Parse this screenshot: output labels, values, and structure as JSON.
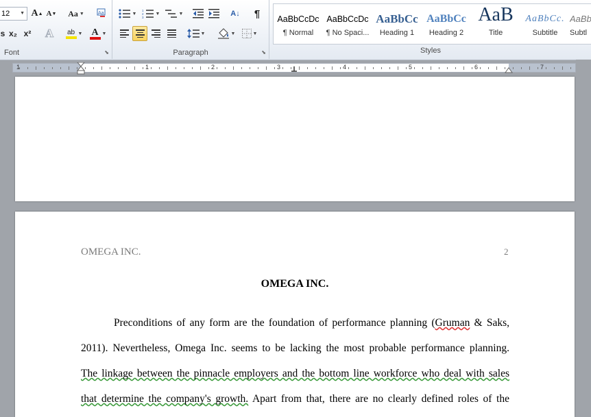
{
  "ribbon": {
    "font": {
      "label": "Font",
      "size_value": "12",
      "grow_label": "A",
      "shrink_label": "A",
      "case_label": "Aa",
      "subscript_label": "x₂",
      "superscript_label": "x²",
      "effects_label": "A",
      "highlight_label": "ab",
      "color_label": "A",
      "clear_label": "A"
    },
    "paragraph": {
      "label": "Paragraph",
      "pilcrow": "¶",
      "sort_label": "A↓"
    },
    "styles": {
      "label": "Styles",
      "items": [
        {
          "preview": "AaBbCcDc",
          "name": "¶ Normal"
        },
        {
          "preview": "AaBbCcDc",
          "name": "¶ No Spaci..."
        },
        {
          "preview": "AaBbCc",
          "name": "Heading 1"
        },
        {
          "preview": "AaBbCc",
          "name": "Heading 2"
        },
        {
          "preview": "AaB",
          "name": "Title"
        },
        {
          "preview": "AaBbCc.",
          "name": "Subtitle"
        },
        {
          "preview": "AaBbCc",
          "name": "Subtl"
        }
      ]
    }
  },
  "ruler": {
    "numbers": [
      "1",
      "1",
      "2",
      "3",
      "4",
      "5",
      "6",
      "7"
    ]
  },
  "document": {
    "header_left": "OMEGA INC.",
    "header_page": "2",
    "title": "OMEGA INC.",
    "lines": [
      {
        "parts": [
          {
            "t": "Preconditions of any form are the foundation of performance planning (",
            "s": ""
          },
          {
            "t": "Gruman",
            "s": "red"
          },
          {
            "t": " & Saks,",
            "s": ""
          }
        ]
      },
      {
        "parts": [
          {
            "t": "2011). Nevertheless, Omega Inc. seems to be lacking the most probable performance planning.",
            "s": ""
          }
        ]
      },
      {
        "parts": [
          {
            "t": "The linkage between the pinnacle employers and the bottom line workforce who deal with sales",
            "s": "green"
          }
        ]
      },
      {
        "parts": [
          {
            "t": "that determine the company's growth.",
            "s": "green"
          },
          {
            "t": " Apart from that, there are no clearly defined roles of the",
            "s": ""
          }
        ]
      }
    ]
  },
  "colors": {
    "highlight": "#f5e400",
    "font_color": "#d11",
    "heading_blue": "#365f91",
    "title_navy": "#17365d"
  }
}
